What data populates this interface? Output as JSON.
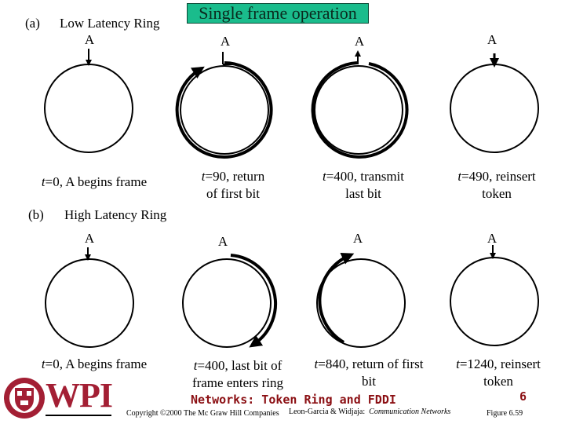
{
  "title": "Single frame operation",
  "section_a": {
    "marker": "(a)",
    "label": "Low Latency Ring"
  },
  "section_b": {
    "marker": "(b)",
    "label": "High Latency Ring"
  },
  "node_label": "A",
  "row_a": [
    {
      "t": "t",
      "caption_line1": "=0, A begins frame",
      "caption_line2": ""
    },
    {
      "t": "t",
      "caption_line1": "=90, return",
      "caption_line2": "of first bit"
    },
    {
      "t": "t",
      "caption_line1": "=400, transmit",
      "caption_line2": "last bit"
    },
    {
      "t": "t",
      "caption_line1": "=490, reinsert",
      "caption_line2": "token"
    }
  ],
  "row_b": [
    {
      "t": "t",
      "caption_line1": "=0, A begins frame",
      "caption_line2": ""
    },
    {
      "t": "t",
      "caption_line1": "=400, last bit of",
      "caption_line2": "frame enters ring"
    },
    {
      "t": "t",
      "caption_line1": "=840, return of first",
      "caption_line2": "bit"
    },
    {
      "t": "t",
      "caption_line1": "=1240, reinsert",
      "caption_line2": "token"
    }
  ],
  "footer": {
    "logo_text": "WPI",
    "course_title": "Networks: Token Ring and FDDI",
    "slide_number": "6",
    "copyright": "Copyright ©2000 The Mc Graw Hill Companies",
    "authors": "Leon-Garcia & Widjaja:",
    "book": "Communication Networks",
    "figure": "Figure 6.59"
  },
  "colors": {
    "title_bg": "#1abc8c",
    "wpi_red": "#a31f34",
    "footer_red": "#8b0f13"
  }
}
